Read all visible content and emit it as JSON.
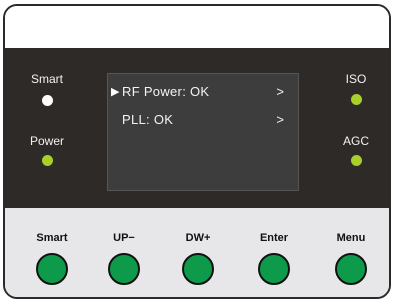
{
  "indicators": {
    "smart": {
      "label": "Smart",
      "color": "#ffffff"
    },
    "power": {
      "label": "Power",
      "color": "#a8cf2a"
    },
    "iso": {
      "label": "ISO",
      "color": "#a8cf2a"
    },
    "agc": {
      "label": "AGC",
      "color": "#a8cf2a"
    }
  },
  "screen": {
    "rows": [
      {
        "label": "RF Power: OK",
        "chevron": ">",
        "selected": true
      },
      {
        "label": "PLL: OK",
        "chevron": ">",
        "selected": false
      }
    ],
    "cursor": "▶"
  },
  "buttons": [
    {
      "label": "Smart"
    },
    {
      "label": "UP−"
    },
    {
      "label": "DW+"
    },
    {
      "label": "Enter"
    },
    {
      "label": "Menu"
    }
  ],
  "colors": {
    "panel": "#2e2a28",
    "button": "#0d9a4a",
    "screen": "#3e3d3d"
  }
}
